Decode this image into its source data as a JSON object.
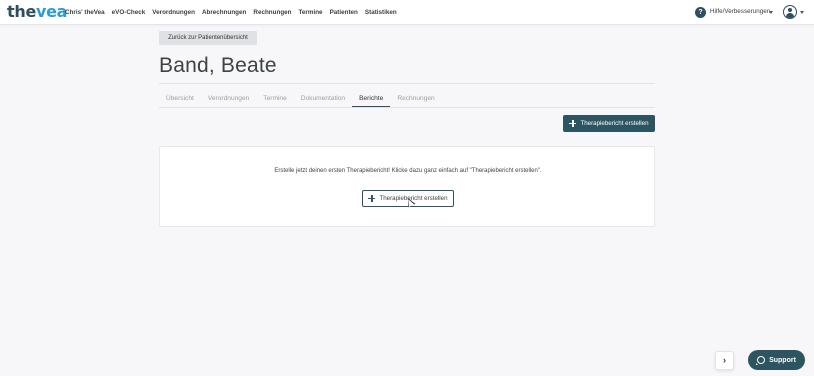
{
  "brand": {
    "logo_main": "the",
    "logo_accent": "vea",
    "logo_accent_color": "#2e9bd6",
    "logo_color": "#2d4f5c"
  },
  "nav": {
    "items": [
      {
        "label": "Chris' theVea"
      },
      {
        "label": "eVO-Check"
      },
      {
        "label": "Verordnungen"
      },
      {
        "label": "Abrechnungen"
      },
      {
        "label": "Rechnungen"
      },
      {
        "label": "Termine"
      },
      {
        "label": "Patienten"
      },
      {
        "label": "Statistiken"
      }
    ],
    "help_icon": "?",
    "help_label": "Hilfe/Verbesserungen",
    "help_caret_icon": "caret-down-icon",
    "avatar_icon": "user-avatar-icon",
    "avatar_caret_icon": "caret-down-icon"
  },
  "page": {
    "back_button": "Zurück zur Patientenübersicht",
    "patient_name": "Band, Beate",
    "tabs": [
      {
        "label": "Übersicht",
        "active": false
      },
      {
        "label": "Verordnungen",
        "active": false
      },
      {
        "label": "Termine",
        "active": false
      },
      {
        "label": "Dokumentation",
        "active": false
      },
      {
        "label": "Berichte",
        "active": true
      },
      {
        "label": "Rechnungen",
        "active": false
      }
    ],
    "create_button": "Therapiebericht erstellen",
    "empty_state": {
      "message": "Erstelle jetzt deinen ersten Therapiebericht! Klicke dazu ganz einfach auf \"Therapiebericht erstellen\".",
      "button": "Therapiebericht erstellen"
    }
  },
  "footer": {
    "chevron_icon": "›",
    "support_label": "Support"
  },
  "colors": {
    "primary": "#2d5561",
    "background": "#f7f7f9"
  }
}
